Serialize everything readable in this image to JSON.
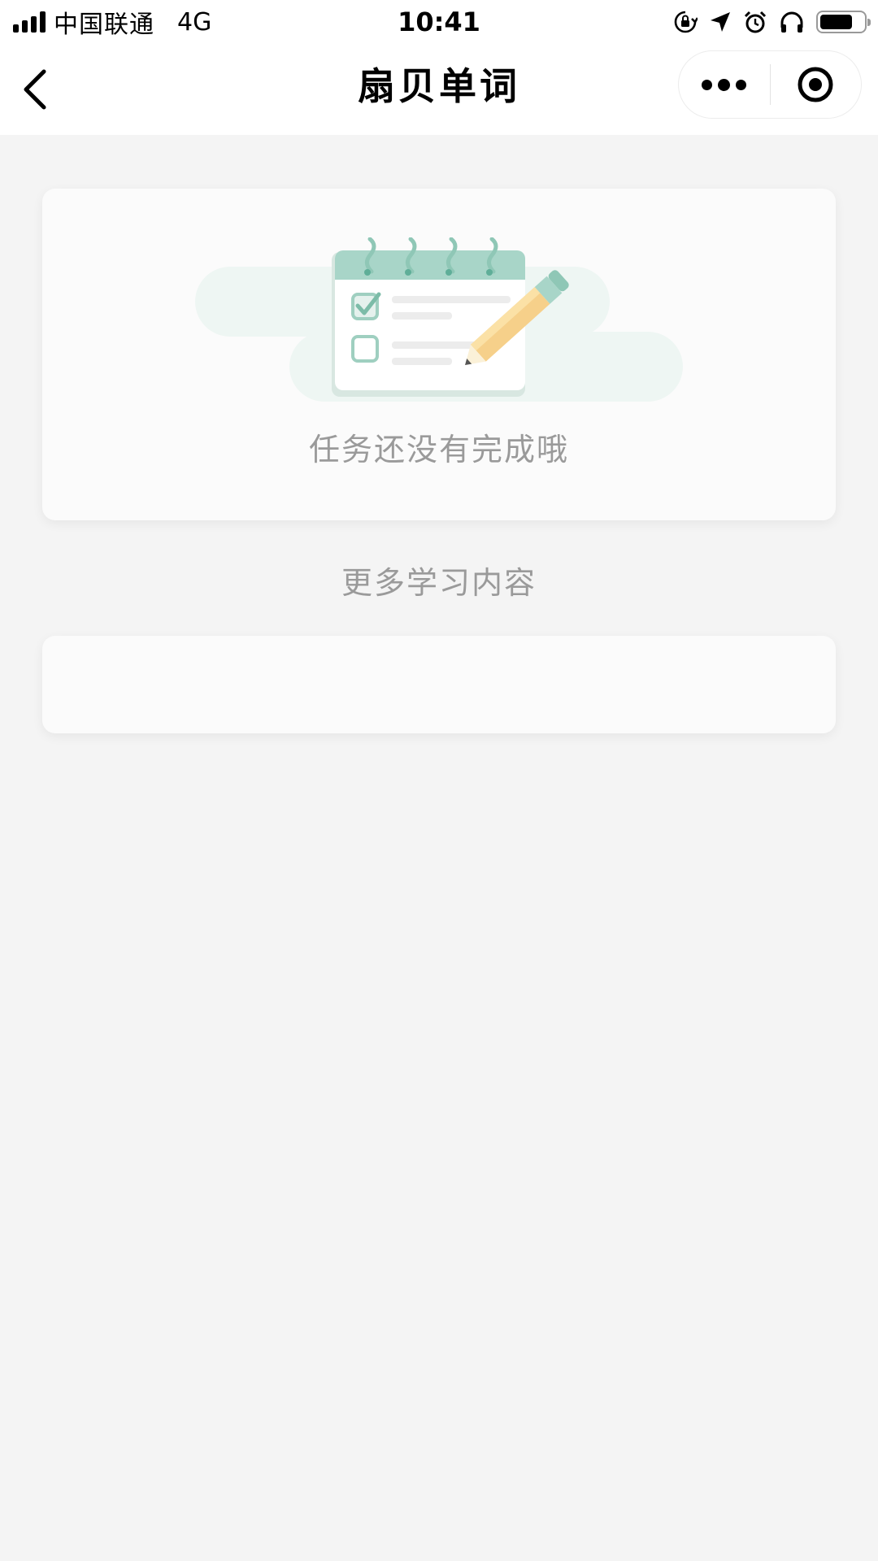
{
  "status_bar": {
    "carrier": "中国联通",
    "network": "4G",
    "time": "10:41",
    "icons": [
      "signal-icon",
      "orientation-lock-icon",
      "location-icon",
      "alarm-icon",
      "headphones-icon",
      "battery-icon"
    ],
    "battery_level": 0.75
  },
  "nav": {
    "title": "扇贝单词",
    "icons": [
      "back-icon",
      "more-icon",
      "close-target-icon"
    ]
  },
  "task": {
    "illustration_icon": "notebook-pencil-icon",
    "empty_text": "任务还没有完成哦"
  },
  "more_section": {
    "title": "更多学习内容"
  },
  "colors": {
    "background": "#f4f4f4",
    "card": "#fbfbfb",
    "muted_text": "#9a9a9a",
    "accent_green": "#a8d5c8"
  }
}
